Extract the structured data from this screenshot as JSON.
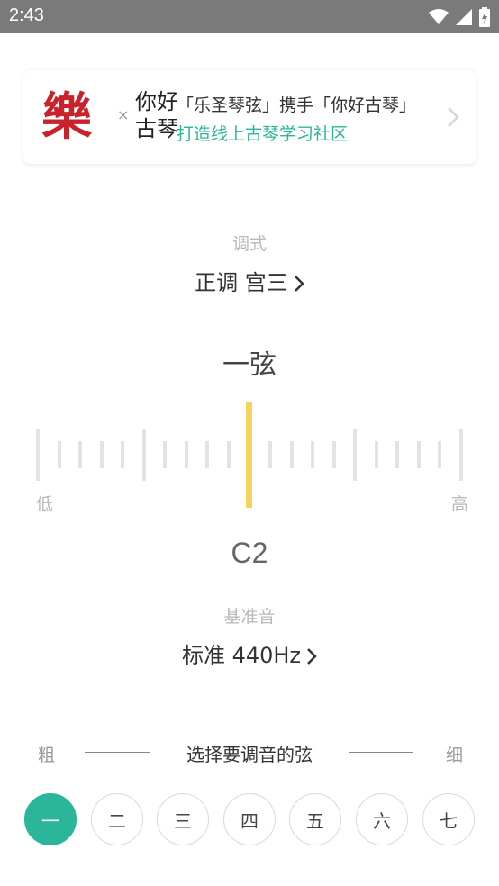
{
  "status": {
    "time": "2:43"
  },
  "banner": {
    "logo_main": "樂",
    "logo_x": "×",
    "logo_partner": "你好古琴",
    "line1": "「乐圣琴弦」携手「你好古琴」",
    "line2": "打造线上古琴学习社区"
  },
  "mode": {
    "label": "调式",
    "value": "正调 宫三"
  },
  "string_title": "一弦",
  "ruler": {
    "low": "低",
    "high": "高"
  },
  "note": "C2",
  "reference": {
    "label": "基准音",
    "value": "标准 440Hz"
  },
  "string_select": {
    "thick": "粗",
    "thin": "细",
    "label": "选择要调音的弦",
    "strings": [
      "一",
      "二",
      "三",
      "四",
      "五",
      "六",
      "七"
    ],
    "selected_index": 0
  },
  "colors": {
    "accent": "#2bb59a",
    "needle": "#f7d35e",
    "brand_red": "#c8232c"
  }
}
